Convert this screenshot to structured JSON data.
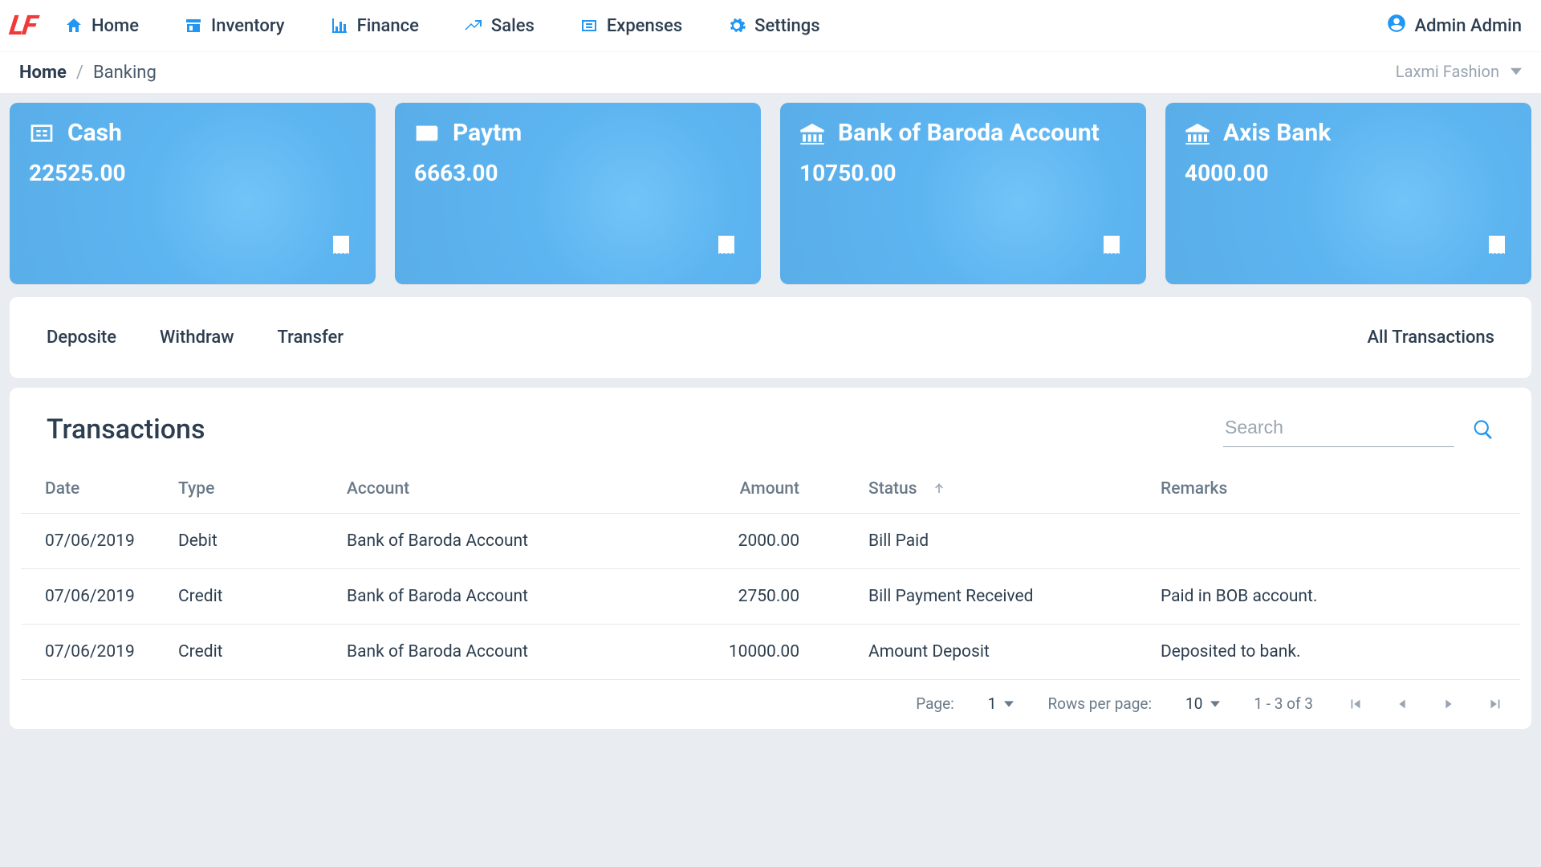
{
  "nav": {
    "items": [
      {
        "label": "Home"
      },
      {
        "label": "Inventory"
      },
      {
        "label": "Finance"
      },
      {
        "label": "Sales"
      },
      {
        "label": "Expenses"
      },
      {
        "label": "Settings"
      }
    ],
    "user_label": "Admin Admin",
    "logo_text": "LF"
  },
  "breadcrumb": {
    "home": "Home",
    "current": "Banking",
    "org": "Laxmi Fashion"
  },
  "accounts": [
    {
      "name": "Cash",
      "amount": "22525.00",
      "icon": "currency-icon"
    },
    {
      "name": "Paytm",
      "amount": "6663.00",
      "icon": "wallet-icon"
    },
    {
      "name": "Bank of Baroda Account",
      "amount": "10750.00",
      "icon": "bank-icon"
    },
    {
      "name": "Axis Bank",
      "amount": "4000.00",
      "icon": "bank-icon"
    }
  ],
  "tabs": {
    "items": [
      "Deposite",
      "Withdraw",
      "Transfer"
    ],
    "right_label": "All Transactions"
  },
  "transactions": {
    "title": "Transactions",
    "search_placeholder": "Search",
    "columns": {
      "date": "Date",
      "type": "Type",
      "account": "Account",
      "amount": "Amount",
      "status": "Status",
      "remarks": "Remarks"
    },
    "sorted_column": "status",
    "sort_direction": "asc",
    "rows": [
      {
        "date": "07/06/2019",
        "type": "Debit",
        "account": "Bank of Baroda Account",
        "amount": "2000.00",
        "status": "Bill Paid",
        "remarks": ""
      },
      {
        "date": "07/06/2019",
        "type": "Credit",
        "account": "Bank of Baroda Account",
        "amount": "2750.00",
        "status": "Bill Payment Received",
        "remarks": "Paid in BOB account."
      },
      {
        "date": "07/06/2019",
        "type": "Credit",
        "account": "Bank of Baroda Account",
        "amount": "10000.00",
        "status": "Amount Deposit",
        "remarks": "Deposited to bank."
      }
    ]
  },
  "paginator": {
    "page_label": "Page:",
    "page": "1",
    "rpp_label": "Rows per page:",
    "rpp": "10",
    "range": "1 - 3 of 3"
  }
}
